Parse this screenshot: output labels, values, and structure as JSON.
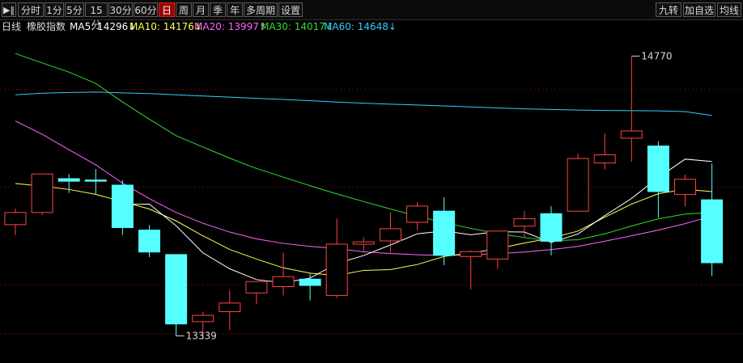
{
  "toolbar": {
    "icon": "play-pause-icon",
    "periods": [
      "分时",
      "1分",
      "5分",
      "15分",
      "30分",
      "60分",
      "日",
      "周",
      "月",
      "季",
      "年",
      "多周期",
      "设置"
    ],
    "active_period": "日",
    "right_buttons": [
      "九转",
      "加自选",
      "均线"
    ]
  },
  "info": {
    "period_label": "日线",
    "instrument": "橡胶指数",
    "ma5": {
      "label": "MA5:",
      "value": "14296",
      "arrow": "↓",
      "color": "#ffffff"
    },
    "ma10": {
      "label": "MA10:",
      "value": "14176",
      "arrow": "↓",
      "color": "#ffff55"
    },
    "ma20": {
      "label": "MA20:",
      "value": "13997",
      "arrow": "↑",
      "color": "#ff66ff"
    },
    "ma30": {
      "label": "MA30:",
      "value": "14017",
      "arrow": "↓",
      "color": "#33dd33"
    },
    "ma60": {
      "label": "MA60:",
      "value": "14648",
      "arrow": "↓",
      "color": "#33ccff"
    }
  },
  "chart_data": {
    "type": "candlestick",
    "ylim": [
      13250,
      14850
    ],
    "grid": true,
    "colors": {
      "up": "#ff4444",
      "down": "#55ffff",
      "grid": "#660000",
      "ma5": "#ffffff",
      "ma10": "#ffff55",
      "ma20": "#ff66ff",
      "ma30": "#33dd33",
      "ma60": "#33ccff"
    },
    "candles": [
      {
        "o": 13908,
        "h": 13990,
        "l": 13854,
        "c": 13970
      },
      {
        "o": 13970,
        "h": 14167,
        "l": 13956,
        "c": 14167
      },
      {
        "o": 14143,
        "h": 14167,
        "l": 14070,
        "c": 14130
      },
      {
        "o": 14136,
        "h": 14192,
        "l": 14062,
        "c": 14130
      },
      {
        "o": 14110,
        "h": 14136,
        "l": 13855,
        "c": 13893
      },
      {
        "o": 13880,
        "h": 13906,
        "l": 13742,
        "c": 13768
      },
      {
        "o": 13755,
        "h": 13755,
        "l": 13339,
        "c": 13400
      },
      {
        "o": 13412,
        "h": 13463,
        "l": 13320,
        "c": 13444
      },
      {
        "o": 13463,
        "h": 13572,
        "l": 13369,
        "c": 13507
      },
      {
        "o": 13559,
        "h": 13591,
        "l": 13501,
        "c": 13617
      },
      {
        "o": 13591,
        "h": 13765,
        "l": 13546,
        "c": 13642
      },
      {
        "o": 13629,
        "h": 13658,
        "l": 13520,
        "c": 13597
      },
      {
        "o": 13546,
        "h": 13939,
        "l": 13533,
        "c": 13808
      },
      {
        "o": 13808,
        "h": 13842,
        "l": 13771,
        "c": 13820
      },
      {
        "o": 13825,
        "h": 13970,
        "l": 13765,
        "c": 13887
      },
      {
        "o": 13920,
        "h": 14023,
        "l": 13881,
        "c": 14003
      },
      {
        "o": 13977,
        "h": 14048,
        "l": 13701,
        "c": 13751
      },
      {
        "o": 13745,
        "h": 13777,
        "l": 13578,
        "c": 13770
      },
      {
        "o": 13732,
        "h": 13855,
        "l": 13681,
        "c": 13875
      },
      {
        "o": 13900,
        "h": 13977,
        "l": 13842,
        "c": 13938
      },
      {
        "o": 13964,
        "h": 14002,
        "l": 13751,
        "c": 13823
      },
      {
        "o": 13977,
        "h": 14272,
        "l": 13977,
        "c": 14246
      },
      {
        "o": 14223,
        "h": 14375,
        "l": 14188,
        "c": 14265
      },
      {
        "o": 14350,
        "h": 14770,
        "l": 14229,
        "c": 14387
      },
      {
        "o": 14310,
        "h": 14335,
        "l": 13944,
        "c": 14077
      },
      {
        "o": 14062,
        "h": 14164,
        "l": 14001,
        "c": 14140
      },
      {
        "o": 14035,
        "h": 14220,
        "l": 13645,
        "c": 13713
      }
    ],
    "ma5": [
      null,
      null,
      null,
      null,
      14011,
      14013,
      13902,
      13764,
      13682,
      13627,
      13610,
      13635,
      13709,
      13750,
      13804,
      13861,
      13876,
      13856,
      13872,
      13870,
      13817,
      13860,
      13954,
      14042,
      14149,
      14243,
      14231
    ],
    "ma10": [
      14118,
      14105,
      14088,
      14063,
      14025,
      13988,
      13927,
      13851,
      13781,
      13732,
      13687,
      13660,
      13648,
      13674,
      13678,
      13704,
      13745,
      13763,
      13785,
      13814,
      13839,
      13875,
      13946,
      14013,
      14066,
      14089,
      14077
    ],
    "ma20": [
      14438,
      14370,
      14291,
      14214,
      14120,
      14041,
      13970,
      13915,
      13870,
      13835,
      13812,
      13797,
      13786,
      13769,
      13760,
      13754,
      13751,
      13753,
      13759,
      13768,
      13780,
      13797,
      13823,
      13851,
      13880,
      13913,
      13952
    ],
    "ma30": [
      14783,
      14735,
      14688,
      14630,
      14535,
      14447,
      14363,
      14305,
      14248,
      14195,
      14151,
      14107,
      14065,
      14026,
      13988,
      13952,
      13918,
      13889,
      13862,
      13842,
      13825,
      13831,
      13861,
      13901,
      13938,
      13962,
      13970
    ],
    "ma60": [
      14572,
      14580,
      14584,
      14586,
      14582,
      14578,
      14572,
      14566,
      14560,
      14554,
      14548,
      14542,
      14535,
      14529,
      14524,
      14520,
      14515,
      14510,
      14505,
      14500,
      14497,
      14494,
      14492,
      14491,
      14490,
      14486,
      14466
    ],
    "high_marker": {
      "label": "14770",
      "index": 23
    },
    "low_marker": {
      "label": "13339",
      "index": 6
    }
  }
}
